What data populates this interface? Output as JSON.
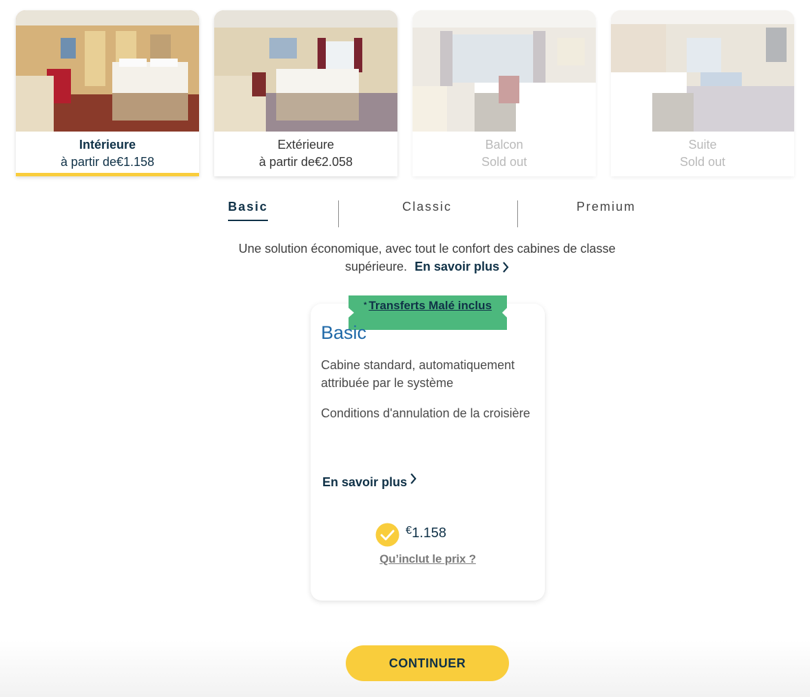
{
  "cabins": [
    {
      "name": "Intérieure",
      "price": "à partir de€1.158",
      "state": "selected",
      "photo_icon": "interior-cabin-photo"
    },
    {
      "name": "Extérieure",
      "price": "à partir de€2.058",
      "state": "available",
      "photo_icon": "exterior-cabin-photo"
    },
    {
      "name": "Balcon",
      "price": "Sold out",
      "state": "sold-out",
      "photo_icon": "balcony-cabin-photo"
    },
    {
      "name": "Suite",
      "price": "Sold out",
      "state": "sold-out",
      "photo_icon": "suite-cabin-photo"
    }
  ],
  "tabs": [
    {
      "label": "Basic",
      "active": true
    },
    {
      "label": "Classic",
      "active": false
    },
    {
      "label": "Premium",
      "active": false
    }
  ],
  "description": {
    "text": "Une solution économique, avec tout le confort des cabines de classe supérieure.",
    "link": "En savoir plus"
  },
  "fare": {
    "ribbon_star": "*",
    "ribbon_text": "Transferts Malé inclus",
    "title": "Basic",
    "features": [
      "Cabine standard, automatiquement attribuée par le système",
      "Conditions d'annulation de la croisière"
    ],
    "more_link": "En savoir plus",
    "currency": "€",
    "price": "1.158",
    "price_info": "Qu’inclut le prix ?",
    "selected": true
  },
  "continue_label": "CONTINUER",
  "colors": {
    "accent_yellow": "#f9cd3c",
    "navy": "#0f3147",
    "ribbon_green": "#4cb87d",
    "title_blue": "#1f69a8"
  }
}
